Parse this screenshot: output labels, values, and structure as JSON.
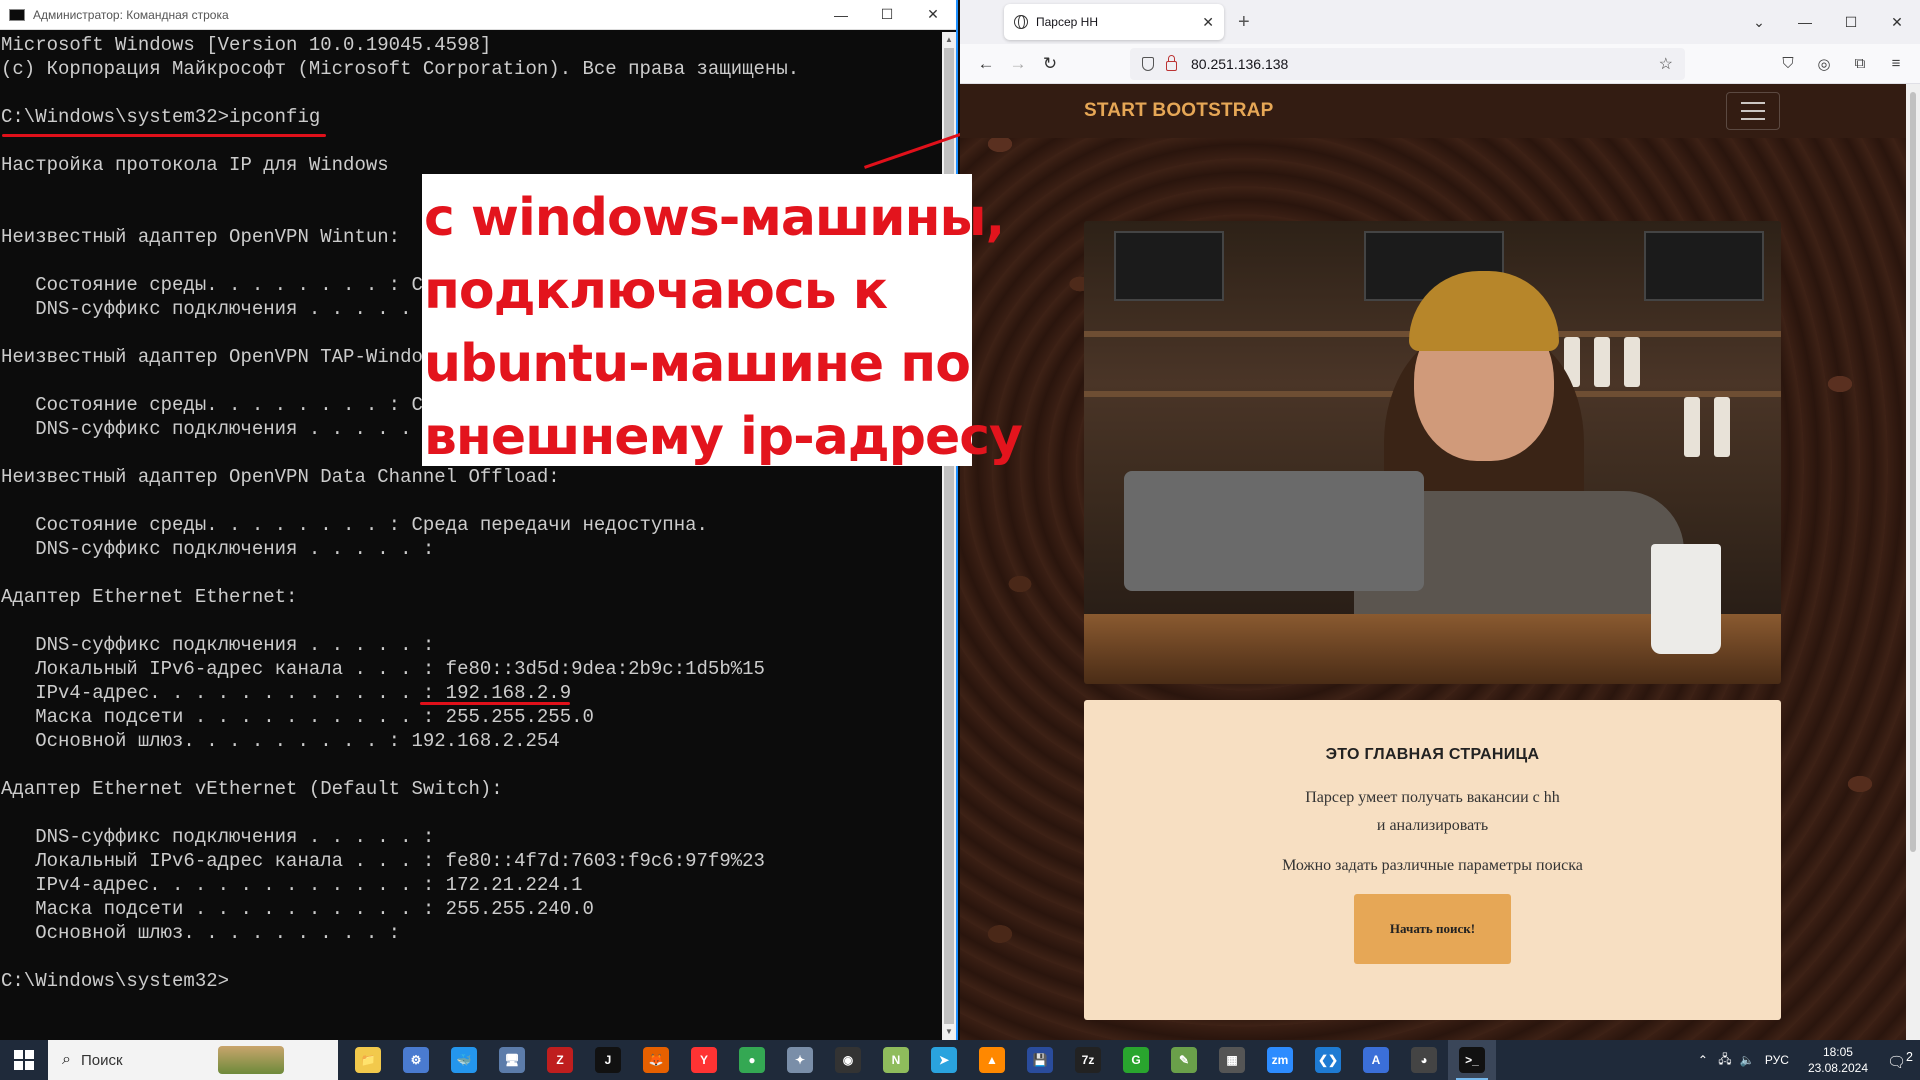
{
  "cmd": {
    "title": "Администратор: Командная строка",
    "lines": [
      "Microsoft Windows [Version 10.0.19045.4598]",
      "(c) Корпорация Майкрософт (Microsoft Corporation). Все права защищены.",
      "",
      "C:\\Windows\\system32>ipconfig",
      "",
      "Настройка протокола IP для Windows",
      "",
      "",
      "Неизвестный адаптер OpenVPN Wintun:",
      "",
      "   Состояние среды. . . . . . . . : Ср",
      "   DNS-суффикс подключения . . . . . :",
      "",
      "Неизвестный адаптер OpenVPN TAP-Window",
      "",
      "   Состояние среды. . . . . . . . : Ср",
      "   DNS-суффикс подключения . . . . . :",
      "",
      "Неизвестный адаптер OpenVPN Data Channel Offload:",
      "",
      "   Состояние среды. . . . . . . . : Среда передачи недоступна.",
      "   DNS-суффикс подключения . . . . . :",
      "",
      "Адаптер Ethernet Ethernet:",
      "",
      "   DNS-суффикс подключения . . . . . :",
      "   Локальный IPv6-адрес канала . . . : fe80::3d5d:9dea:2b9c:1d5b%15",
      "   IPv4-адрес. . . . . . . . . . . . : 192.168.2.9",
      "   Маска подсети . . . . . . . . . . : 255.255.255.0",
      "   Основной шлюз. . . . . . . . . : 192.168.2.254",
      "",
      "Адаптер Ethernet vEthernet (Default Switch):",
      "",
      "   DNS-суффикс подключения . . . . . :",
      "   Локальный IPv6-адрес канала . . . : fe80::4f7d:7603:f9c6:97f9%23",
      "   IPv4-адрес. . . . . . . . . . . . : 172.21.224.1",
      "   Маска подсети . . . . . . . . . . : 255.255.240.0",
      "   Основной шлюз. . . . . . . . . :",
      "",
      "C:\\Windows\\system32>"
    ]
  },
  "annotation": {
    "lines": [
      "с windows-машины,",
      "подключаюсь к",
      "ubuntu-машине по",
      "внешнему ip-адресу"
    ],
    "color": "#e3141d"
  },
  "browser": {
    "tab_title": "Парсер HH",
    "url": "80.251.136.138",
    "page": {
      "brand": "START BOOTSTRAP",
      "heading": "ЭТО ГЛАВНАЯ СТРАНИЦА",
      "para1_line1": "Парсер умеет получать вакансии с hh",
      "para1_line2": "и анализировать",
      "para2": "Можно задать различные параметры поиска",
      "button": "Начать поиск!",
      "accent_color": "#e6a756",
      "card_color": "#f7dfc2"
    }
  },
  "taskbar": {
    "search_placeholder": "Поиск",
    "apps": [
      {
        "name": "file-explorer",
        "glyph": "📁",
        "color": "#f2c94c"
      },
      {
        "name": "network-app",
        "glyph": "⚙",
        "color": "#4a7bd0"
      },
      {
        "name": "docker",
        "glyph": "🐳",
        "color": "#2496ed"
      },
      {
        "name": "remote-desktop",
        "glyph": "🖥",
        "color": "#5c7caa"
      },
      {
        "name": "filezilla",
        "glyph": "Z",
        "color": "#bf1e1e"
      },
      {
        "name": "jetbrains",
        "glyph": "J",
        "color": "#111111"
      },
      {
        "name": "firefox",
        "glyph": "🦊",
        "color": "#e66000"
      },
      {
        "name": "yandex-browser",
        "glyph": "Y",
        "color": "#ff3333"
      },
      {
        "name": "chrome",
        "glyph": "●",
        "color": "#34a853"
      },
      {
        "name": "app-bird",
        "glyph": "✦",
        "color": "#7a8ea8"
      },
      {
        "name": "app-cat",
        "glyph": "◉",
        "color": "#333333"
      },
      {
        "name": "notepad-plus",
        "glyph": "N",
        "color": "#8fbc5c"
      },
      {
        "name": "telegram",
        "glyph": "➤",
        "color": "#2aa3de"
      },
      {
        "name": "vlc",
        "glyph": "▲",
        "color": "#ff8800"
      },
      {
        "name": "floppy-save",
        "glyph": "💾",
        "color": "#2a4c9c"
      },
      {
        "name": "7zip",
        "glyph": "7z",
        "color": "#222222"
      },
      {
        "name": "green-app",
        "glyph": "G",
        "color": "#29a52e"
      },
      {
        "name": "notepad-edit",
        "glyph": "✎",
        "color": "#6aa04a"
      },
      {
        "name": "calculator",
        "glyph": "▦",
        "color": "#555555"
      },
      {
        "name": "zoom",
        "glyph": "zm",
        "color": "#2d8cff"
      },
      {
        "name": "vscode",
        "glyph": "❮❯",
        "color": "#1e7bd3"
      },
      {
        "name": "app-a",
        "glyph": "A",
        "color": "#3b6fd8"
      },
      {
        "name": "app-mascot",
        "glyph": "◕",
        "color": "#444444"
      },
      {
        "name": "command-prompt",
        "glyph": ">_",
        "color": "#111111"
      }
    ],
    "language": "РУС",
    "time": "18:05",
    "date": "23.08.2024",
    "notifications": "2"
  }
}
